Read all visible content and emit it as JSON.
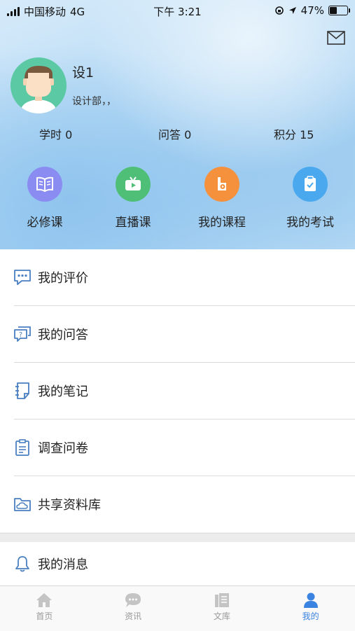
{
  "status_bar": {
    "carrier": "中国移动",
    "network": "4G",
    "time": "下午 3:21",
    "battery": "47%",
    "battery_level": 0.47
  },
  "profile": {
    "name": "设1",
    "department": "设计部，，"
  },
  "stats": [
    {
      "label": "学时",
      "value": "0"
    },
    {
      "label": "问答",
      "value": "0"
    },
    {
      "label": "积分",
      "value": "15"
    }
  ],
  "quick_actions": [
    {
      "label": "必修课",
      "icon": "book-icon",
      "color": "#8b8cf2"
    },
    {
      "label": "直播课",
      "icon": "live-tv-icon",
      "color": "#4fbf78"
    },
    {
      "label": "我的课程",
      "icon": "course-play-icon",
      "color": "#f5913d"
    },
    {
      "label": "我的考试",
      "icon": "exam-check-icon",
      "color": "#4aa8ef"
    }
  ],
  "menu": [
    {
      "label": "我的评价",
      "icon": "comment-dots-icon"
    },
    {
      "label": "我的问答",
      "icon": "question-bubble-icon"
    },
    {
      "label": "我的笔记",
      "icon": "notebook-icon"
    },
    {
      "label": "调查问卷",
      "icon": "clipboard-icon"
    },
    {
      "label": "共享资料库",
      "icon": "cloud-folder-icon"
    }
  ],
  "messages": {
    "label": "我的消息",
    "icon": "bell-icon"
  },
  "tabs": [
    {
      "label": "首页",
      "icon": "home-icon",
      "active": false
    },
    {
      "label": "资讯",
      "icon": "chat-bubble-icon",
      "active": false
    },
    {
      "label": "文库",
      "icon": "library-icon",
      "active": false
    },
    {
      "label": "我的",
      "icon": "person-icon",
      "active": true
    }
  ],
  "colors": {
    "accent": "#3a83e0",
    "icon_blue": "#4a7fc1",
    "inactive": "#c4c4c4"
  }
}
